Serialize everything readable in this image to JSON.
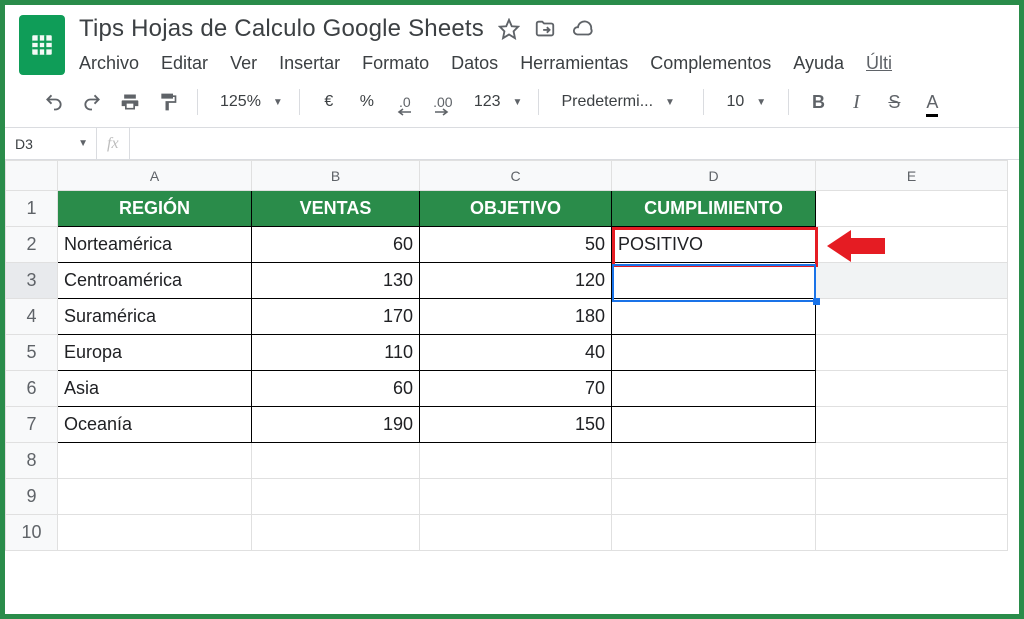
{
  "doc": {
    "title": "Tips Hojas de Calculo Google Sheets"
  },
  "menu": {
    "archivo": "Archivo",
    "editar": "Editar",
    "ver": "Ver",
    "insertar": "Insertar",
    "formato": "Formato",
    "datos": "Datos",
    "herramientas": "Herramientas",
    "complementos": "Complementos",
    "ayuda": "Ayuda",
    "ultima": "Últi"
  },
  "toolbar": {
    "zoom": "125%",
    "currency": "€",
    "percent": "%",
    "dec_dec": ".0",
    "dec_inc": ".00",
    "more_formats": "123",
    "font": "Predetermi...",
    "font_size": "10",
    "bold": "B",
    "italic": "I",
    "strike": "S",
    "textcolor": "A"
  },
  "fx": {
    "cell_ref": "D3",
    "fx_label": "fx",
    "formula": ""
  },
  "columns": [
    "A",
    "B",
    "C",
    "D",
    "E"
  ],
  "rows": [
    "1",
    "2",
    "3",
    "4",
    "5",
    "6",
    "7",
    "8",
    "9",
    "10"
  ],
  "table": {
    "headers": {
      "region": "REGIÓN",
      "ventas": "VENTAS",
      "objetivo": "OBJETIVO",
      "cumplimiento": "CUMPLIMIENTO"
    },
    "rows": [
      {
        "region": "Norteamérica",
        "ventas": "60",
        "objetivo": "50",
        "cumplimiento": "POSITIVO"
      },
      {
        "region": "Centroamérica",
        "ventas": "130",
        "objetivo": "120",
        "cumplimiento": ""
      },
      {
        "region": "Suramérica",
        "ventas": "170",
        "objetivo": "180",
        "cumplimiento": ""
      },
      {
        "region": "Europa",
        "ventas": "110",
        "objetivo": "40",
        "cumplimiento": ""
      },
      {
        "region": "Asia",
        "ventas": "60",
        "objetivo": "70",
        "cumplimiento": ""
      },
      {
        "region": "Oceanía",
        "ventas": "190",
        "objetivo": "150",
        "cumplimiento": ""
      }
    ]
  }
}
